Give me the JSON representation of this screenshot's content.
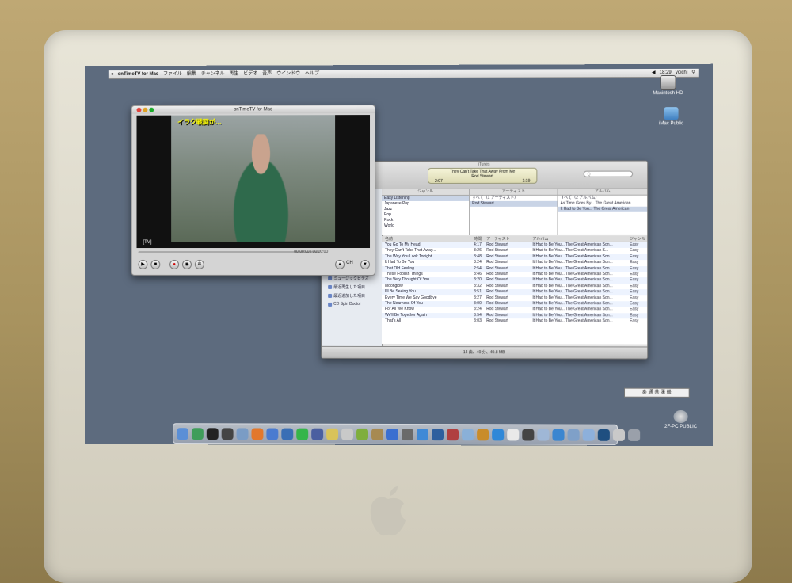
{
  "menubar": {
    "app_name": "onTimeTV for Mac",
    "items": [
      "ファイル",
      "編集",
      "チャンネル",
      "再生",
      "ビデオ",
      "音声",
      "ウインドウ",
      "ヘルプ"
    ],
    "clock": "18:29",
    "user": "yoichi"
  },
  "desktop": {
    "hd_label": "Macintosh HD",
    "public_label": "iMac Public",
    "network_label": "2F-PC PUBLIC"
  },
  "tv": {
    "title": "onTimeTV for Mac",
    "caption": "イラク戦闘が…",
    "channel_tag": "[TV]",
    "timecode": "00:00:00 | 00:00:00",
    "ch_label": "CH"
  },
  "itunes": {
    "title": "iTunes",
    "now_playing_title": "They Can't Take That Away From Me",
    "now_playing_artist": "Rod Stewart",
    "elapsed": "2:07",
    "remaining": "-1:19",
    "search_placeholder": "Q",
    "browser": {
      "genre_header": "ジャンル",
      "artist_header": "アーティスト",
      "album_header": "アルバム",
      "genres": [
        "Easy Listening",
        "Japanese Pop",
        "Jazz",
        "Pop",
        "Rock",
        "World"
      ],
      "artists": [
        "すべて（1 アーティスト）",
        "Rod Stewart"
      ],
      "albums": [
        "すべて（2 アルバム）",
        "As Time Goes By... The Great American",
        "It Had to Be You... The Great American"
      ]
    },
    "sources": [
      "ミュージックビデオ",
      "最近再生した項目",
      "最近追加した項目",
      "CD Spin Doctor"
    ],
    "columns": {
      "name": "名前",
      "time": "時間",
      "artist": "アーティスト",
      "album": "アルバム",
      "genre": "ジャンル"
    },
    "tracks": [
      {
        "name": "You Go To My Head",
        "time": "4:17",
        "artist": "Rod Stewart",
        "album": "It Had to Be You... The Great American Son...",
        "genre": "Easy"
      },
      {
        "name": "They Can't Take That Away...",
        "time": "3:26",
        "artist": "Rod Stewart",
        "album": "It Had to Be You... The Great American S...",
        "genre": "Easy"
      },
      {
        "name": "The Way You Look Tonight",
        "time": "3:48",
        "artist": "Rod Stewart",
        "album": "It Had to Be You... The Great American Son...",
        "genre": "Easy"
      },
      {
        "name": "It Had To Be You",
        "time": "3:24",
        "artist": "Rod Stewart",
        "album": "It Had to Be You... The Great American Son...",
        "genre": "Easy"
      },
      {
        "name": "That Old Feeling",
        "time": "2:54",
        "artist": "Rod Stewart",
        "album": "It Had to Be You... The Great American Son...",
        "genre": "Easy"
      },
      {
        "name": "These Foolish Things",
        "time": "3:46",
        "artist": "Rod Stewart",
        "album": "It Had to Be You... The Great American Son...",
        "genre": "Easy"
      },
      {
        "name": "The Very Thought Of You",
        "time": "3:20",
        "artist": "Rod Stewart",
        "album": "It Had to Be You... The Great American Son...",
        "genre": "Easy"
      },
      {
        "name": "Moonglow",
        "time": "3:32",
        "artist": "Rod Stewart",
        "album": "It Had to Be You... The Great American Son...",
        "genre": "Easy"
      },
      {
        "name": "I'll Be Seeing You",
        "time": "3:51",
        "artist": "Rod Stewart",
        "album": "It Had to Be You... The Great American Son...",
        "genre": "Easy"
      },
      {
        "name": "Every Time We Say Goodbye",
        "time": "3:27",
        "artist": "Rod Stewart",
        "album": "It Had to Be You... The Great American Son...",
        "genre": "Easy"
      },
      {
        "name": "The Nearness Of You",
        "time": "3:00",
        "artist": "Rod Stewart",
        "album": "It Had to Be You... The Great American Son...",
        "genre": "Easy"
      },
      {
        "name": "For All We Know",
        "time": "3:24",
        "artist": "Rod Stewart",
        "album": "It Had to Be You... The Great American Son...",
        "genre": "Easy"
      },
      {
        "name": "We'll Be Together Again",
        "time": "3:54",
        "artist": "Rod Stewart",
        "album": "It Had to Be You... The Great American Son...",
        "genre": "Easy"
      },
      {
        "name": "That's All",
        "time": "3:03",
        "artist": "Rod Stewart",
        "album": "It Had to Be You... The Great American Son...",
        "genre": "Easy"
      }
    ],
    "status": "14 曲、49 分、49.8 MB"
  },
  "menu_extra": "あ 通 共 漢 般",
  "colors": {
    "screen_bg": "#5d6b7e",
    "selection": "#c9d4e6",
    "lcd": "#f5f4d8"
  }
}
